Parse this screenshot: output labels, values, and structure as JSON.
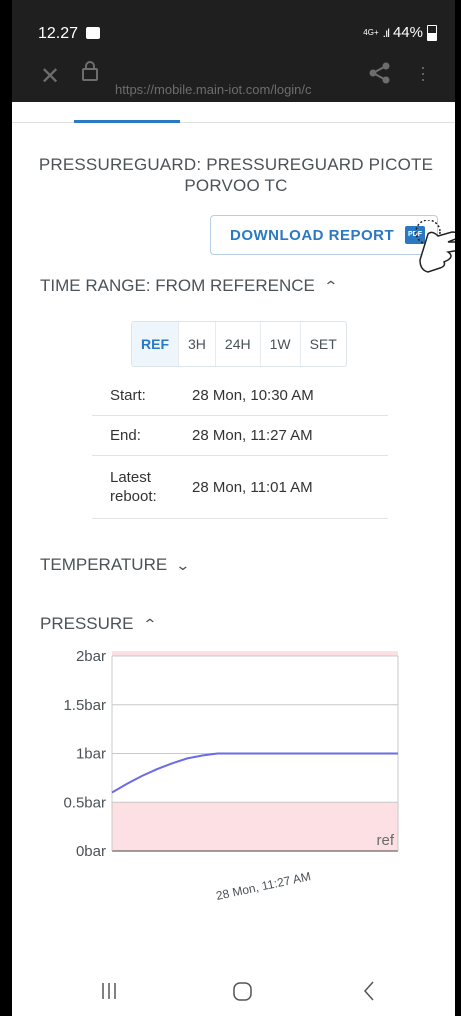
{
  "status_bar": {
    "time": "12.27",
    "network": "4G+",
    "battery": "44%"
  },
  "browser": {
    "url": "https://mobile.main-iot.com/login/c"
  },
  "title": "PRESSUREGUARD: PRESSUREGUARD PICOTE PORVOO TC",
  "download_button": {
    "label": "DOWNLOAD REPORT",
    "icon_text": "PDF"
  },
  "time_range": {
    "heading": "TIME RANGE: FROM REFERENCE",
    "options": [
      "REF",
      "3H",
      "24H",
      "1W",
      "SET"
    ],
    "selected": "REF",
    "start_label": "Start:",
    "start_value": "28 Mon, 10:30 AM",
    "end_label": "End:",
    "end_value": "28 Mon, 11:27 AM",
    "reboot_label": "Latest reboot:",
    "reboot_value": "28 Mon, 11:01 AM"
  },
  "temperature": {
    "heading": "TEMPERATURE"
  },
  "pressure": {
    "heading": "PRESSURE"
  },
  "colors": {
    "accent": "#2b79c2",
    "line": "#6b6be6",
    "band": "#fde0e3"
  },
  "chart_data": {
    "type": "line",
    "title": "",
    "xlabel": "",
    "ylabel": "",
    "yticks": [
      "2bar",
      "1.5bar",
      "1bar",
      "0.5bar",
      "0bar"
    ],
    "ylim": [
      0,
      2
    ],
    "xticks": [
      "28 Mon, 11:27 AM"
    ],
    "x": [
      "10:30",
      "10:33",
      "10:36",
      "10:39",
      "10:42",
      "10:45",
      "10:48",
      "10:51",
      "10:57",
      "11:05",
      "11:15",
      "11:27"
    ],
    "series": [
      {
        "values": [
          0.6,
          0.69,
          0.77,
          0.84,
          0.9,
          0.95,
          0.98,
          1.0,
          1.0,
          1.0,
          1.0,
          1.0
        ]
      }
    ],
    "bands": [
      {
        "from": 0,
        "to": 0.5,
        "label": "ref"
      },
      {
        "from": 2,
        "to": 2.05
      }
    ],
    "grid": true
  }
}
